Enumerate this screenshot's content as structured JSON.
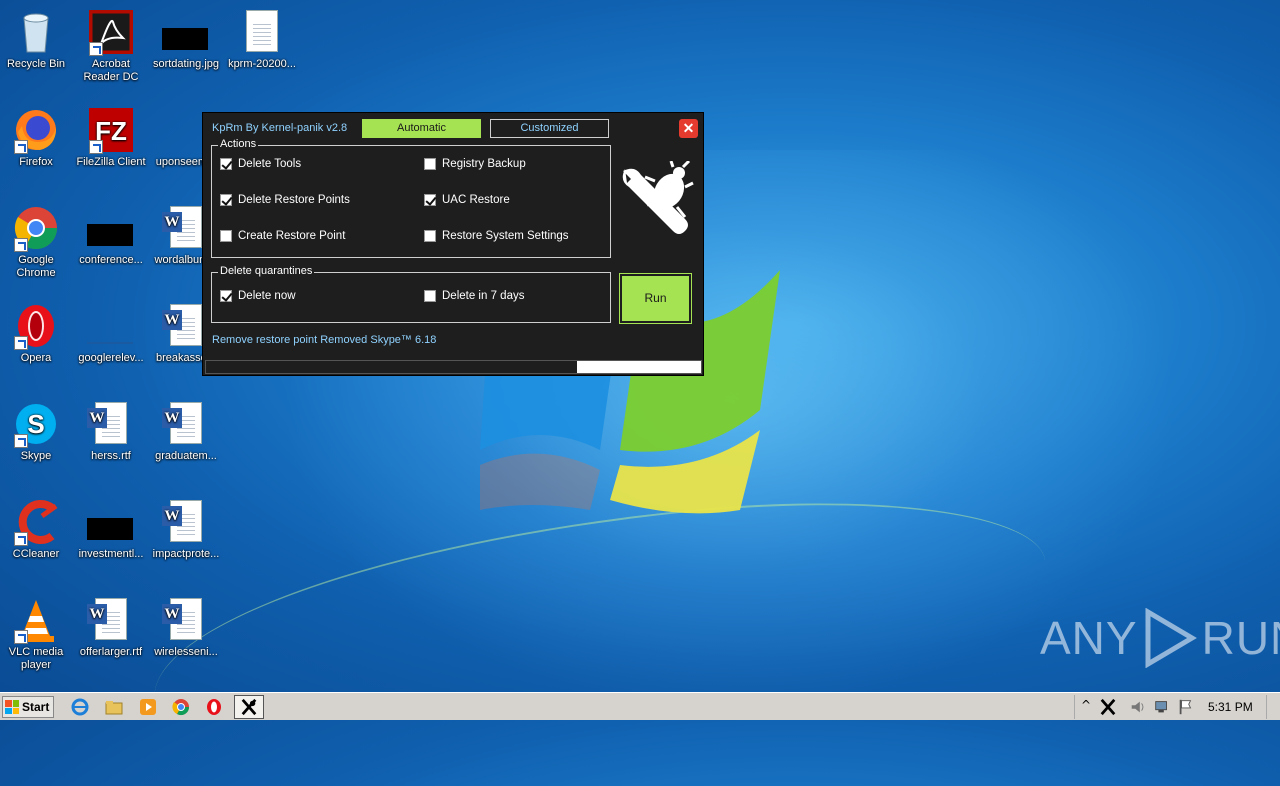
{
  "desktop": {
    "icons": [
      {
        "label": "Recycle Bin"
      },
      {
        "label": "Acrobat Reader DC"
      },
      {
        "label": "sortdating.jpg"
      },
      {
        "label": "kprm-20200..."
      },
      {
        "label": "Firefox"
      },
      {
        "label": "FileZilla Client"
      },
      {
        "label": "uponseem..."
      },
      {
        "label": "Google Chrome"
      },
      {
        "label": "conference..."
      },
      {
        "label": "wordalbum..."
      },
      {
        "label": "Opera"
      },
      {
        "label": "googlerelev..."
      },
      {
        "label": "breakasso..."
      },
      {
        "label": "Skype"
      },
      {
        "label": "herss.rtf"
      },
      {
        "label": "graduatem..."
      },
      {
        "label": "CCleaner"
      },
      {
        "label": "investmentl..."
      },
      {
        "label": "impactprote..."
      },
      {
        "label": "VLC media player"
      },
      {
        "label": "offerlarger.rtf"
      },
      {
        "label": "wirelesseni..."
      }
    ],
    "watermark_left": "ANY",
    "watermark_right": "RUN"
  },
  "app": {
    "title": "KpRm By Kernel-panik v2.8",
    "tabs": {
      "automatic": "Automatic",
      "customized": "Customized"
    },
    "close_glyph": "✕",
    "actions_group": {
      "legend": "Actions",
      "options": [
        {
          "label": "Delete Tools",
          "checked": true
        },
        {
          "label": "Registry Backup",
          "checked": false
        },
        {
          "label": "Delete Restore Points",
          "checked": true
        },
        {
          "label": "UAC Restore",
          "checked": true
        },
        {
          "label": "Create Restore Point",
          "checked": false
        },
        {
          "label": "Restore System Settings",
          "checked": false
        }
      ]
    },
    "quarantine_group": {
      "legend": "Delete quarantines",
      "options": [
        {
          "label": "Delete now",
          "checked": true
        },
        {
          "label": "Delete in 7 days",
          "checked": false
        }
      ]
    },
    "run_label": "Run",
    "status": "Remove restore point Removed Skype™ 6.18",
    "progress": 0.75
  },
  "taskbar": {
    "start_label": "Start",
    "clock": "5:31 PM"
  },
  "colors": {
    "accent_green": "#a6e352",
    "title_blue": "#8fd2ff",
    "window_bg": "#1e1e1e",
    "close_red": "#e53b2f"
  }
}
